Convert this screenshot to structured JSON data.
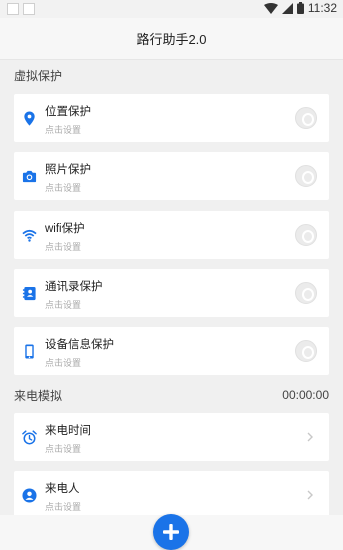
{
  "status": {
    "time": "11:32"
  },
  "header": {
    "title": "路行助手2.0"
  },
  "sections": {
    "virtual": {
      "title": "虚拟保护"
    },
    "call": {
      "title": "来电模拟",
      "timer": "00:00:00"
    }
  },
  "protect_items": [
    {
      "label": "位置保护",
      "sub": "点击设置",
      "icon": "location-pin-icon"
    },
    {
      "label": "照片保护",
      "sub": "点击设置",
      "icon": "camera-icon"
    },
    {
      "label": "wifi保护",
      "sub": "点击设置",
      "icon": "wifi-icon"
    },
    {
      "label": "通讯录保护",
      "sub": "点击设置",
      "icon": "contacts-icon"
    },
    {
      "label": "设备信息保护",
      "sub": "点击设置",
      "icon": "phone-icon"
    }
  ],
  "call_items": [
    {
      "label": "来电时间",
      "sub": "点击设置",
      "icon": "alarm-clock-icon"
    },
    {
      "label": "来电人",
      "sub": "点击设置",
      "icon": "person-icon"
    }
  ],
  "colors": {
    "accent": "#1a73e8",
    "background": "#f0f0f0",
    "card": "#ffffff",
    "subtext": "#aaaaaa"
  }
}
